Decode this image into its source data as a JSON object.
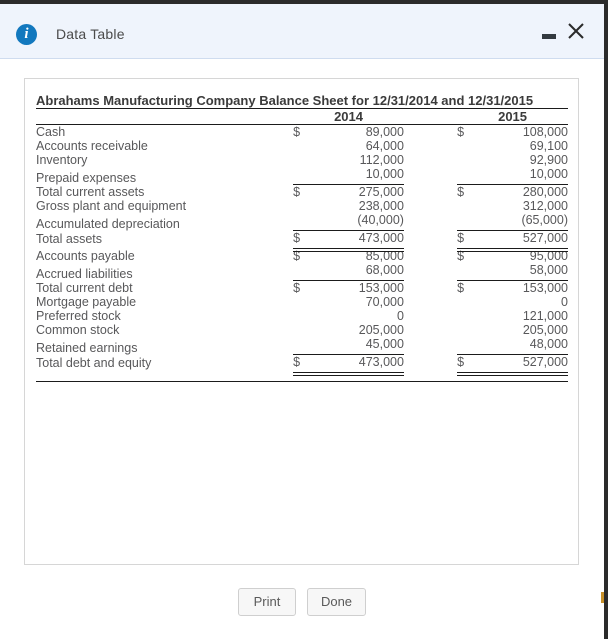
{
  "window": {
    "title": "Data Table",
    "info_icon": "info-icon",
    "minimize_label": "–",
    "close_label": "✕"
  },
  "table": {
    "title": "Abrahams Manufacturing Company Balance Sheet for 12/31/2014 and 12/31/2015",
    "columns": [
      "",
      "2014",
      "2015"
    ],
    "rows": [
      {
        "label": "Cash",
        "c2014_cur": "$",
        "c2014": "89,000",
        "c2015_cur": "$",
        "c2015": "108,000",
        "rule": "none"
      },
      {
        "label": "Accounts receivable",
        "c2014_cur": "",
        "c2014": "64,000",
        "c2015_cur": "",
        "c2015": "69,100",
        "rule": "none"
      },
      {
        "label": "Inventory",
        "c2014_cur": "",
        "c2014": "112,000",
        "c2015_cur": "",
        "c2015": "92,900",
        "rule": "none"
      },
      {
        "label": "Prepaid expenses",
        "c2014_cur": "",
        "c2014": "10,000",
        "c2015_cur": "",
        "c2015": "10,000",
        "rule": "single"
      },
      {
        "label": "Total current assets",
        "c2014_cur": "$",
        "c2014": "275,000",
        "c2015_cur": "$",
        "c2015": "280,000",
        "rule": "none"
      },
      {
        "label": "Gross plant and equipment",
        "c2014_cur": "",
        "c2014": "238,000",
        "c2015_cur": "",
        "c2015": "312,000",
        "rule": "none"
      },
      {
        "label": "Accumulated depreciation",
        "c2014_cur": "",
        "c2014": "(40,000)",
        "c2015_cur": "",
        "c2015": "(65,000)",
        "rule": "single"
      },
      {
        "label": "Total assets",
        "c2014_cur": "$",
        "c2014": "473,000",
        "c2015_cur": "$",
        "c2015": "527,000",
        "rule": "double"
      },
      {
        "label": "Accounts payable",
        "c2014_cur": "$",
        "c2014": "85,000",
        "c2015_cur": "$",
        "c2015": "95,000",
        "rule": "none"
      },
      {
        "label": "Accrued liabilities",
        "c2014_cur": "",
        "c2014": "68,000",
        "c2015_cur": "",
        "c2015": "58,000",
        "rule": "single"
      },
      {
        "label": "Total current debt",
        "c2014_cur": "$",
        "c2014": "153,000",
        "c2015_cur": "$",
        "c2015": "153,000",
        "rule": "none"
      },
      {
        "label": "Mortgage payable",
        "c2014_cur": "",
        "c2014": "70,000",
        "c2015_cur": "",
        "c2015": "0",
        "rule": "none"
      },
      {
        "label": "Preferred stock",
        "c2014_cur": "",
        "c2014": "0",
        "c2015_cur": "",
        "c2015": "121,000",
        "rule": "none"
      },
      {
        "label": "Common stock",
        "c2014_cur": "",
        "c2014": "205,000",
        "c2015_cur": "",
        "c2015": "205,000",
        "rule": "none"
      },
      {
        "label": "Retained earnings",
        "c2014_cur": "",
        "c2014": "45,000",
        "c2015_cur": "",
        "c2015": "48,000",
        "rule": "single"
      },
      {
        "label": "Total debt and equity",
        "c2014_cur": "$",
        "c2014": "473,000",
        "c2015_cur": "$",
        "c2015": "527,000",
        "rule": "double"
      }
    ]
  },
  "footer": {
    "print_label": "Print",
    "done_label": "Done"
  },
  "colors": {
    "titlebar_bg": "#eff4fc",
    "info_icon_blue": "#1278be",
    "text": "#58585a",
    "rule": "#1b1b1b"
  }
}
